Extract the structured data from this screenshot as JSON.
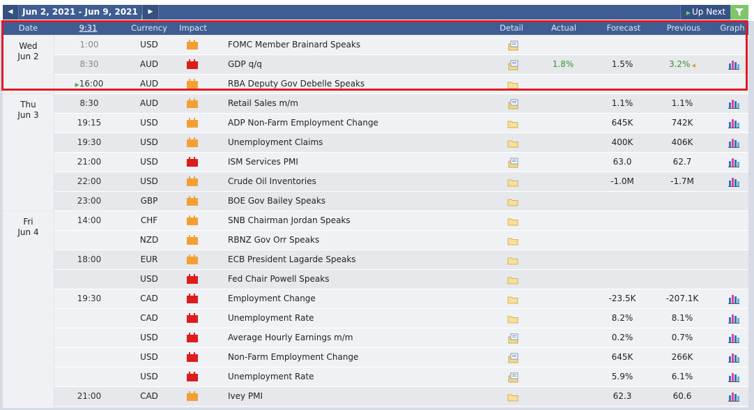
{
  "nav": {
    "prev_icon": "◀",
    "next_icon": "▶",
    "range": "Jun 2, 2021 - Jun 9, 2021",
    "up_next": "Up Next",
    "filter_icon": "filter-icon"
  },
  "header": {
    "date": "Date",
    "time": "9:31",
    "currency": "Currency",
    "impact": "Impact",
    "detail": "Detail",
    "actual": "Actual",
    "forecast": "Forecast",
    "previous": "Previous",
    "graph": "Graph"
  },
  "days": [
    {
      "weekday": "Wed",
      "date": "Jun 2"
    },
    {
      "weekday": "Thu",
      "date": "Jun 3"
    },
    {
      "weekday": "Fri",
      "date": "Jun 4"
    }
  ],
  "rows": [
    {
      "time": "1:00",
      "currency": "USD",
      "impact": "medium",
      "event": "FOMC Member Brainard Speaks",
      "actual": "",
      "forecast": "",
      "previous": "",
      "graph": false
    },
    {
      "time": "8:30",
      "currency": "AUD",
      "impact": "high",
      "event": "GDP q/q",
      "actual": "1.8%",
      "forecast": "1.5%",
      "previous": "3.2%",
      "graph": true
    },
    {
      "time": "16:00",
      "currency": "AUD",
      "impact": "medium",
      "event": "RBA Deputy Gov Debelle Speaks",
      "actual": "",
      "forecast": "",
      "previous": "",
      "graph": false
    },
    {
      "time": "8:30",
      "currency": "AUD",
      "impact": "medium",
      "event": "Retail Sales m/m",
      "actual": "",
      "forecast": "1.1%",
      "previous": "1.1%",
      "graph": true
    },
    {
      "time": "19:15",
      "currency": "USD",
      "impact": "medium",
      "event": "ADP Non-Farm Employment Change",
      "actual": "",
      "forecast": "645K",
      "previous": "742K",
      "graph": true
    },
    {
      "time": "19:30",
      "currency": "USD",
      "impact": "medium",
      "event": "Unemployment Claims",
      "actual": "",
      "forecast": "400K",
      "previous": "406K",
      "graph": true
    },
    {
      "time": "21:00",
      "currency": "USD",
      "impact": "high",
      "event": "ISM Services PMI",
      "actual": "",
      "forecast": "63.0",
      "previous": "62.7",
      "graph": true
    },
    {
      "time": "22:00",
      "currency": "USD",
      "impact": "medium",
      "event": "Crude Oil Inventories",
      "actual": "",
      "forecast": "-1.0M",
      "previous": "-1.7M",
      "graph": true
    },
    {
      "time": "23:00",
      "currency": "GBP",
      "impact": "medium",
      "event": "BOE Gov Bailey Speaks",
      "actual": "",
      "forecast": "",
      "previous": "",
      "graph": false
    },
    {
      "time": "14:00",
      "currency": "CHF",
      "impact": "medium",
      "event": "SNB Chairman Jordan Speaks",
      "actual": "",
      "forecast": "",
      "previous": "",
      "graph": false
    },
    {
      "time": "",
      "currency": "NZD",
      "impact": "medium",
      "event": "RBNZ Gov Orr Speaks",
      "actual": "",
      "forecast": "",
      "previous": "",
      "graph": false
    },
    {
      "time": "18:00",
      "currency": "EUR",
      "impact": "medium",
      "event": "ECB President Lagarde Speaks",
      "actual": "",
      "forecast": "",
      "previous": "",
      "graph": false
    },
    {
      "time": "",
      "currency": "USD",
      "impact": "high",
      "event": "Fed Chair Powell Speaks",
      "actual": "",
      "forecast": "",
      "previous": "",
      "graph": false
    },
    {
      "time": "19:30",
      "currency": "CAD",
      "impact": "high",
      "event": "Employment Change",
      "actual": "",
      "forecast": "-23.5K",
      "previous": "-207.1K",
      "graph": true
    },
    {
      "time": "",
      "currency": "CAD",
      "impact": "high",
      "event": "Unemployment Rate",
      "actual": "",
      "forecast": "8.2%",
      "previous": "8.1%",
      "graph": true
    },
    {
      "time": "",
      "currency": "USD",
      "impact": "high",
      "event": "Average Hourly Earnings m/m",
      "actual": "",
      "forecast": "0.2%",
      "previous": "0.7%",
      "graph": true
    },
    {
      "time": "",
      "currency": "USD",
      "impact": "high",
      "event": "Non-Farm Employment Change",
      "actual": "",
      "forecast": "645K",
      "previous": "266K",
      "graph": true
    },
    {
      "time": "",
      "currency": "USD",
      "impact": "high",
      "event": "Unemployment Rate",
      "actual": "",
      "forecast": "5.9%",
      "previous": "6.1%",
      "graph": true
    },
    {
      "time": "21:00",
      "currency": "CAD",
      "impact": "medium",
      "event": "Ivey PMI",
      "actual": "",
      "forecast": "62.3",
      "previous": "60.6",
      "graph": true
    }
  ],
  "colors": {
    "header": "#3f5d92",
    "high_impact": "#dd1c1c",
    "medium_impact": "#f3a033",
    "better": "#2f9a2f",
    "highlight": "#e01b24"
  }
}
